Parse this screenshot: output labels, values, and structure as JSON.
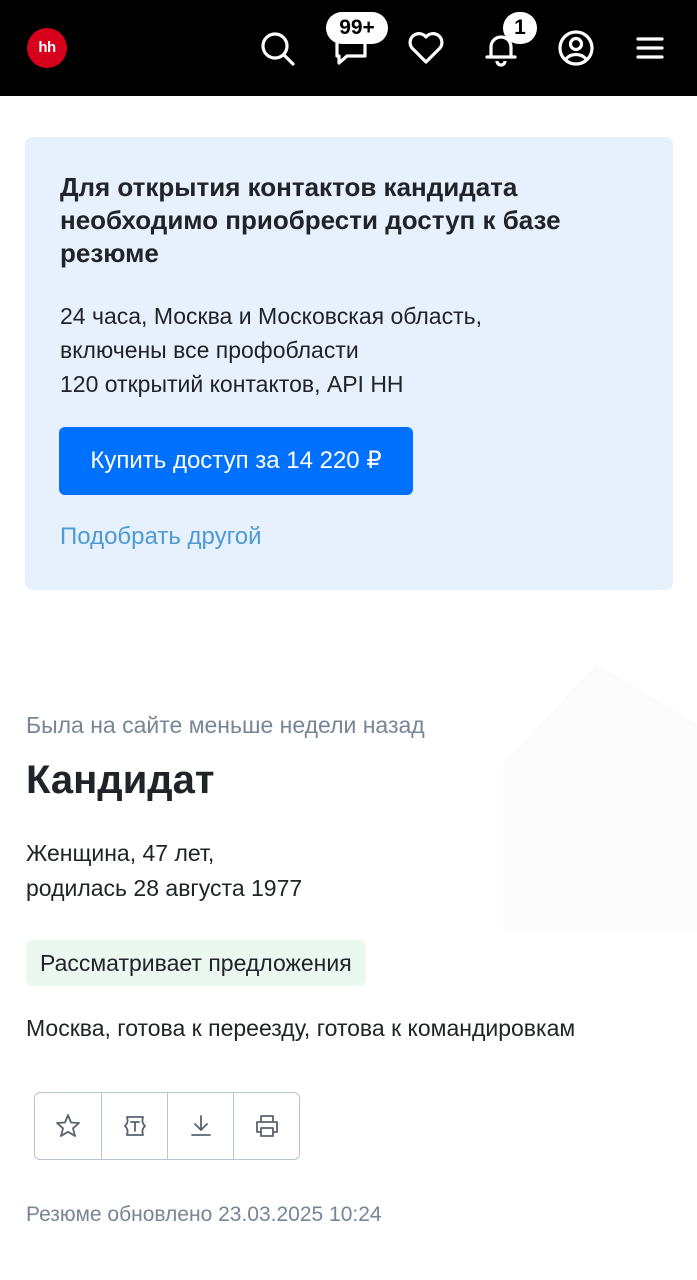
{
  "header": {
    "logo_text": "hh",
    "messages_badge": "99+",
    "notifications_badge": "1"
  },
  "banner": {
    "title": "Для открытия контактов кандидата необходимо приобрести доступ к базе резюме",
    "desc_line1": "24 часа, Москва и Московская область,",
    "desc_line2": "включены все профобласти",
    "desc_line3": "120 открытий контактов, API HH",
    "buy_label": "Купить доступ за 14 220 ₽",
    "alt_label": "Подобрать другой"
  },
  "profile": {
    "last_seen": "Была на сайте меньше недели назад",
    "title": "Кандидат",
    "gender_age": "Женщина, 47 лет,",
    "birth": "родилась 28 августа 1977",
    "status": "Рассматривает предложения",
    "location": "Москва, готова к переезду, готова к командировкам",
    "updated": "Резюме обновлено 23.03.2025 10:24"
  },
  "colors": {
    "accent": "#0070ff",
    "brand": "#d6001c",
    "banner_bg": "#e6f1fd",
    "status_bg": "#eaf8ef"
  }
}
